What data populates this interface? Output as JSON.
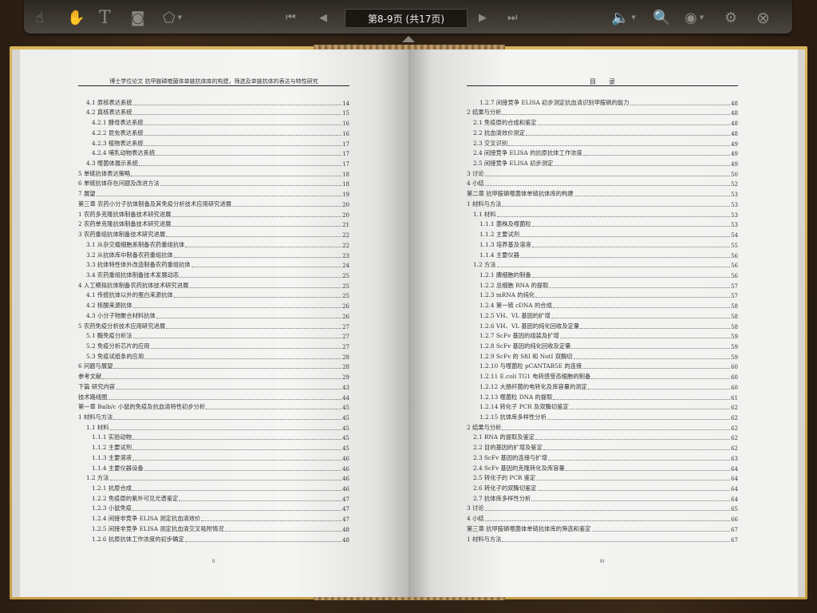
{
  "toolbar": {
    "tools": [
      {
        "name": "pointer-tool-icon",
        "glyph": "☝"
      },
      {
        "name": "hand-tool-icon",
        "glyph": "✋"
      },
      {
        "name": "text-tool-icon",
        "glyph": "T"
      },
      {
        "name": "snapshot-camera-icon",
        "glyph": "◙"
      },
      {
        "name": "shape-tool-icon",
        "glyph": "⬠"
      }
    ],
    "page_indicator": "第8-9页 (共17页)",
    "nav": {
      "first": "⏮",
      "prev": "◀",
      "next": "▶",
      "last": "⏭"
    },
    "right_tools": {
      "sound": "🔈",
      "zoom": "🔍",
      "view": "◉",
      "settings": "⚙",
      "close": "⊗"
    }
  },
  "left_page": {
    "header": "博士学位论文 抗甲胺磷噬菌体单链抗体库的构建，筛选及单链抗体的表达与特性研究",
    "page_number": "II",
    "entries": [
      {
        "level": 1,
        "text": "4.1 原核表达系统",
        "page": "14"
      },
      {
        "level": 1,
        "text": "4.2 真核表达系统",
        "page": "15"
      },
      {
        "level": 2,
        "text": "4.2.1 酵母表达系统",
        "page": "16"
      },
      {
        "level": 2,
        "text": "4.2.2 昆虫表达系统",
        "page": "16"
      },
      {
        "level": 2,
        "text": "4.2.3 植物表达系统",
        "page": "17"
      },
      {
        "level": 2,
        "text": "4.2.4 哺乳动物表达系统",
        "page": "17"
      },
      {
        "level": 1,
        "text": "4.3 噬菌体展示系统",
        "page": "17"
      },
      {
        "level": 0,
        "text": "5 单链抗体表达策略",
        "page": "18"
      },
      {
        "level": 0,
        "text": "6 单链抗体存在问题及改进方法",
        "page": "18"
      },
      {
        "level": 0,
        "text": "7 展望",
        "page": "19"
      },
      {
        "level": 0,
        "text": "第三章 农药小分子抗体制备及其免疫分析技术应用研究进展",
        "page": "20"
      },
      {
        "level": 0,
        "text": "1 农药多克隆抗体制备技术研究进展",
        "page": "20"
      },
      {
        "level": 0,
        "text": "2 农药单克隆抗体制备技术研究进展",
        "page": "21"
      },
      {
        "level": 0,
        "text": "3 农药重组抗体制备技术研究进展",
        "page": "22"
      },
      {
        "level": 1,
        "text": "3.1 从杂交瘤细胞系制备农药重组抗体",
        "page": "22"
      },
      {
        "level": 1,
        "text": "3.2 从抗体库中制备农药重组抗体",
        "page": "23"
      },
      {
        "level": 1,
        "text": "3.3 抗体特性体外改造制备农药重组抗体",
        "page": "24"
      },
      {
        "level": 1,
        "text": "3.4 农药重组抗体制备技术发展动态",
        "page": "25"
      },
      {
        "level": 0,
        "text": "4 人工模拟抗体制备农药抗体技术研究进展",
        "page": "25"
      },
      {
        "level": 1,
        "text": "4.1 传统抗体以外的蛋白来源抗体",
        "page": "25"
      },
      {
        "level": 1,
        "text": "4.2 核酸来源抗体",
        "page": "26"
      },
      {
        "level": 1,
        "text": "4.3 小分子物聚合材料抗体",
        "page": "26"
      },
      {
        "level": 0,
        "text": "5 农药免疫分析技术应用研究进展",
        "page": "27"
      },
      {
        "level": 1,
        "text": "5.1 酶免疫分析法",
        "page": "27"
      },
      {
        "level": 1,
        "text": "5.2 免疫分析芯片的应用",
        "page": "27"
      },
      {
        "level": 1,
        "text": "5.3 免疫试纸条的应用",
        "page": "28"
      },
      {
        "level": 0,
        "text": "6 问题与展望",
        "page": "28"
      },
      {
        "level": 0,
        "text": "参考文献",
        "page": "29"
      },
      {
        "level": 0,
        "text": "下篇 研究内容",
        "page": "43"
      },
      {
        "level": 0,
        "text": "技术路线图",
        "page": "44"
      },
      {
        "level": 0,
        "text": "第一章 Balb/c 小鼠的免疫及抗血清特性初步分析",
        "page": "45"
      },
      {
        "level": 0,
        "text": "1 材料与方法",
        "page": "45"
      },
      {
        "level": 1,
        "text": "1.1 材料",
        "page": "45"
      },
      {
        "level": 2,
        "text": "1.1.1 实验动物",
        "page": "45"
      },
      {
        "level": 2,
        "text": "1.1.2 主要试剂",
        "page": "45"
      },
      {
        "level": 2,
        "text": "1.1.3 主要溶液",
        "page": "46"
      },
      {
        "level": 2,
        "text": "1.1.4 主要仪器设备",
        "page": "46"
      },
      {
        "level": 1,
        "text": "1.2 方法",
        "page": "46"
      },
      {
        "level": 2,
        "text": "1.2.1 抗原合成",
        "page": "46"
      },
      {
        "level": 2,
        "text": "1.2.2 免疫原的紫外可见光谱鉴定",
        "page": "47"
      },
      {
        "level": 2,
        "text": "1.2.3 小鼠免疫",
        "page": "47"
      },
      {
        "level": 2,
        "text": "1.2.4 间接非竞争 ELISA 测定抗血清效价",
        "page": "47"
      },
      {
        "level": 2,
        "text": "1.2.5 间接非竞争 ELISA 测定抗血清交叉吸附情况",
        "page": "48"
      },
      {
        "level": 2,
        "text": "1.2.6 抗原抗体工作浓度的初步确定",
        "page": "48"
      }
    ]
  },
  "right_page": {
    "header": "目　　录",
    "page_number": "III",
    "entries": [
      {
        "level": 2,
        "text": "1.2.7 间接竞争 ELISA 初步测定抗血清识别甲胺磷的能力",
        "page": "48"
      },
      {
        "level": 0,
        "text": "2 结果与分析",
        "page": "48"
      },
      {
        "level": 1,
        "text": "2.1 免疫原的合成和鉴定",
        "page": "48"
      },
      {
        "level": 1,
        "text": "2.2 抗血清效价测定",
        "page": "48"
      },
      {
        "level": 1,
        "text": "2.3 交叉识别",
        "page": "49"
      },
      {
        "level": 1,
        "text": "2.4 间接竞争 ELISA 的抗原抗体工作浓度",
        "page": "49"
      },
      {
        "level": 1,
        "text": "2.5 间接竞争 ELISA 初步测定",
        "page": "49"
      },
      {
        "level": 0,
        "text": "3 讨论",
        "page": "50"
      },
      {
        "level": 0,
        "text": "4 小结",
        "page": "52"
      },
      {
        "level": 0,
        "text": "第二章 抗甲胺磷噬菌体单链抗体库的构建",
        "page": "53"
      },
      {
        "level": 0,
        "text": "1 材料与方法",
        "page": "53"
      },
      {
        "level": 1,
        "text": "1.1 材料",
        "page": "53"
      },
      {
        "level": 2,
        "text": "1.1.1 菌株及噬菌粒",
        "page": "53"
      },
      {
        "level": 2,
        "text": "1.1.2 主要试剂",
        "page": "54"
      },
      {
        "level": 2,
        "text": "1.1.3 培养基及溶液",
        "page": "55"
      },
      {
        "level": 2,
        "text": "1.1.4 主要仪器",
        "page": "56"
      },
      {
        "level": 1,
        "text": "1.2 方法",
        "page": "56"
      },
      {
        "level": 2,
        "text": "1.2.1 脾细胞的制备",
        "page": "56"
      },
      {
        "level": 2,
        "text": "1.2.2 总细胞 RNA 的提取",
        "page": "57"
      },
      {
        "level": 2,
        "text": "1.2.3 mRNA 的纯化",
        "page": "57"
      },
      {
        "level": 2,
        "text": "1.2.4 第一链 cDNA 的合成",
        "page": "58"
      },
      {
        "level": 2,
        "text": "1.2.5 VH、VL 基因的扩增",
        "page": "58"
      },
      {
        "level": 2,
        "text": "1.2.6 VH、VL 基因的纯化回收及定量",
        "page": "58"
      },
      {
        "level": 2,
        "text": "1.2.7 ScFv 基因的组装及扩增",
        "page": "59"
      },
      {
        "level": 2,
        "text": "1.2.8 ScFv 基因的纯化回收及定量",
        "page": "59"
      },
      {
        "level": 2,
        "text": "1.2.9 ScFv 的 SfiI 和 NotI 双酶切",
        "page": "59"
      },
      {
        "level": 2,
        "text": "1.2.10 与噬菌粒 pCANTAB5E 的连接",
        "page": "60"
      },
      {
        "level": 2,
        "text": "1.2.11 E.coli TG1 电转感受态细胞的制备",
        "page": "60"
      },
      {
        "level": 2,
        "text": "1.2.12 大肠杆菌的电转化及库容量的测定",
        "page": "60"
      },
      {
        "level": 2,
        "text": "1.2.13 噬菌粒 DNA 的提取",
        "page": "61"
      },
      {
        "level": 2,
        "text": "1.2.14 转化子 PCR 及双酶切鉴定",
        "page": "62"
      },
      {
        "level": 2,
        "text": "1.2.15 抗体库多样性分析",
        "page": "62"
      },
      {
        "level": 0,
        "text": "2 结果与分析",
        "page": "62"
      },
      {
        "level": 1,
        "text": "2.1 RNA 的提取及鉴定",
        "page": "62"
      },
      {
        "level": 1,
        "text": "2.2 目的基因的扩增及鉴定",
        "page": "62"
      },
      {
        "level": 1,
        "text": "2.3 ScFv 基因的连接与扩增",
        "page": "63"
      },
      {
        "level": 1,
        "text": "2.4 ScFv 基因的克隆转化及库容量",
        "page": "64"
      },
      {
        "level": 1,
        "text": "2.5 转化子的 PCR 鉴定",
        "page": "64"
      },
      {
        "level": 1,
        "text": "2.6 转化子的双酶切鉴定",
        "page": "64"
      },
      {
        "level": 1,
        "text": "2.7 抗体库多样性分析",
        "page": "64"
      },
      {
        "level": 0,
        "text": "3 讨论",
        "page": "65"
      },
      {
        "level": 0,
        "text": "4 小结",
        "page": "66"
      },
      {
        "level": 0,
        "text": "第三章 抗甲胺磷噬菌体单链抗体库的筛选和鉴定",
        "page": "67"
      },
      {
        "level": 0,
        "text": "1 材料与方法",
        "page": "67"
      }
    ]
  }
}
